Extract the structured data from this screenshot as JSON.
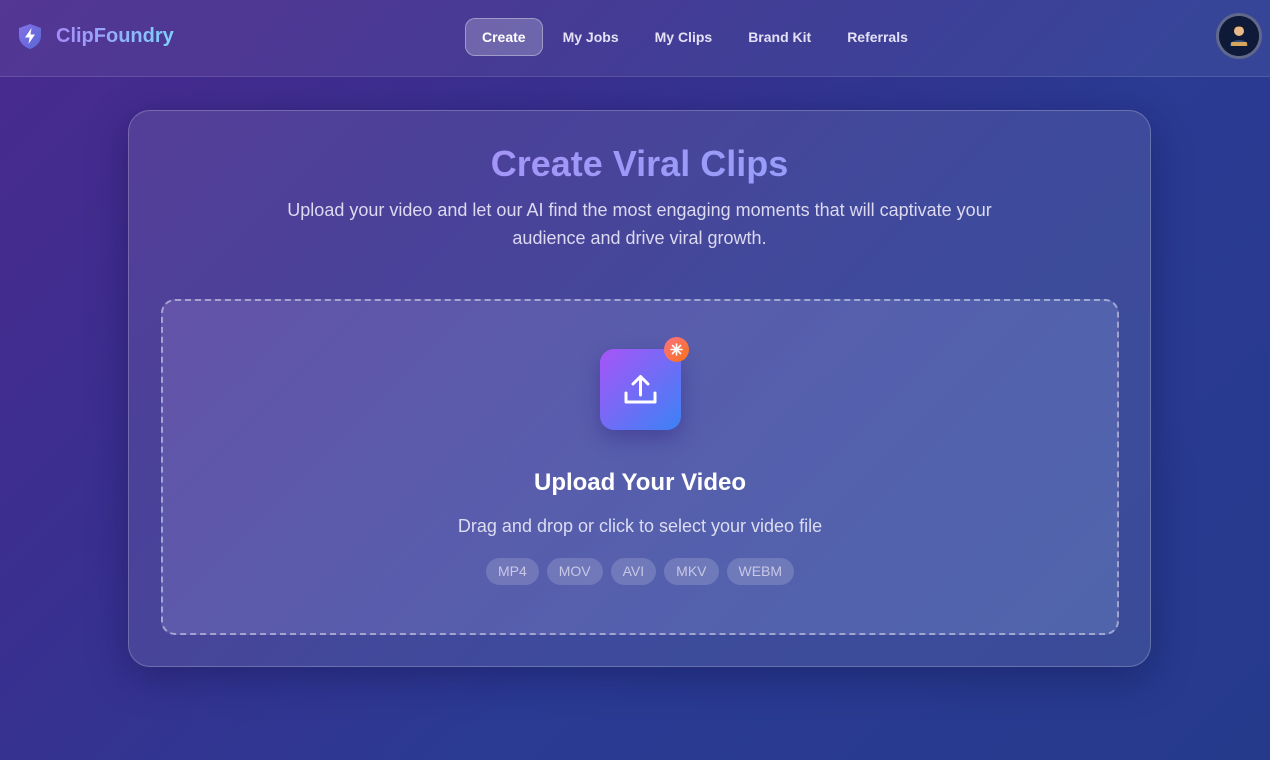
{
  "brand": {
    "name": "ClipFoundry",
    "logo_icon": "lightning-shield-icon"
  },
  "nav": {
    "items": [
      {
        "label": "Create",
        "active": true
      },
      {
        "label": "My Jobs",
        "active": false
      },
      {
        "label": "My Clips",
        "active": false
      },
      {
        "label": "Brand Kit",
        "active": false
      },
      {
        "label": "Referrals",
        "active": false
      }
    ]
  },
  "user": {
    "avatar_icon": "user-avatar-icon"
  },
  "hero": {
    "title": "Create Viral Clips",
    "subtitle": "Upload your video and let our AI find the most engaging moments that will captivate your audience and drive viral growth."
  },
  "upload": {
    "icon": "upload-icon",
    "badge_icon": "sparkle-icon",
    "title": "Upload Your Video",
    "subtitle": "Drag and drop or click to select your video file",
    "formats": [
      "MP4",
      "MOV",
      "AVI",
      "MKV",
      "WEBM"
    ]
  },
  "colors": {
    "accent_start": "#a855f7",
    "accent_end": "#3b82f6",
    "badge": "#fb7185"
  }
}
